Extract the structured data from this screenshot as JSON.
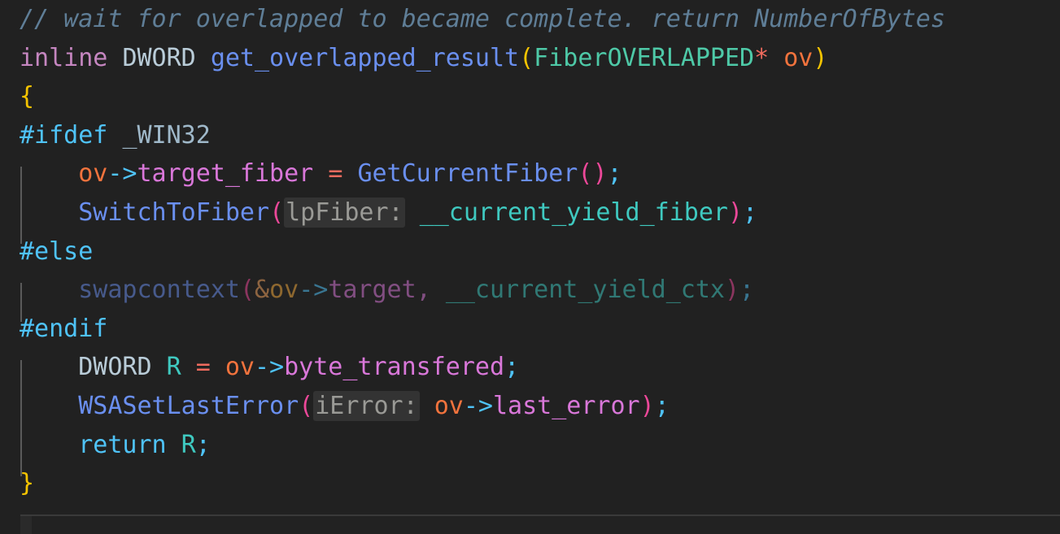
{
  "editor": {
    "language": "C++",
    "background_color": "#212121",
    "font_size_px": 30,
    "line_height_px": 47.6,
    "indent_guide_color": "#5a5a5a",
    "inlay_hint_background": "#333333",
    "inlay_hint_color": "#9a9a96"
  },
  "colors": {
    "comment": "#5f7e97",
    "keyword": "#c586c0",
    "type": "#b9ccd8",
    "function": "#6a8fef",
    "class_name": "#4ec9a7",
    "operator_red": "#f06b5e",
    "variable": "#f2733d",
    "arrow": "#4fc3f7",
    "member": "#d977d9",
    "brace_yellow": "#f5c400",
    "paren_magenta": "#ec4899",
    "preprocessor": "#4fc3f7",
    "macro": "#9fb8c9",
    "global": "#3fc9c0",
    "local": "#3fc9c0"
  },
  "code": {
    "line1": {
      "comment": "// wait for overlapped to became complete. return NumberOfBytes"
    },
    "line2": {
      "keyword": "inline",
      "space1": " ",
      "type": "DWORD",
      "space2": " ",
      "function": "get_overlapped_result",
      "paren_open": "(",
      "class_name": "FiberOVERLAPPED",
      "star": "*",
      "space3": " ",
      "param": "ov",
      "paren_close": ")"
    },
    "line3": {
      "brace_open": "{"
    },
    "line4": {
      "preproc": "#ifdef",
      "space": " ",
      "macro": "_WIN32"
    },
    "line5": {
      "indent": "    ",
      "var": "ov",
      "arrow": "->",
      "member": "target_fiber",
      "space1": " ",
      "equals": "=",
      "space2": " ",
      "function": "GetCurrentFiber",
      "paren_open": "(",
      "paren_close": ")",
      "semicolon": ";"
    },
    "line6": {
      "indent": "    ",
      "function": "SwitchToFiber",
      "paren_open": "(",
      "inlay_hint": "lpFiber:",
      "space": " ",
      "arg": "__current_yield_fiber",
      "paren_close": ")",
      "semicolon": ";"
    },
    "line7": {
      "preproc": "#else"
    },
    "line8": {
      "indent": "    ",
      "function": "swapcontext",
      "paren_open": "(",
      "ampersand": "&",
      "var": "ov",
      "arrow": "->",
      "member": "target",
      "comma": ",",
      "space": " ",
      "arg": "__current_yield_ctx",
      "paren_close": ")",
      "semicolon": ";",
      "state": "inactive-preprocessor-branch"
    },
    "line9": {
      "preproc": "#endif"
    },
    "line10": {
      "indent": "    ",
      "type": "DWORD",
      "space1": " ",
      "local": "R",
      "space2": " ",
      "equals": "=",
      "space3": " ",
      "var": "ov",
      "arrow": "->",
      "member": "byte_transfered",
      "semicolon": ";"
    },
    "line11": {
      "indent": "    ",
      "function": "WSASetLastError",
      "paren_open": "(",
      "inlay_hint": "iError:",
      "space": " ",
      "var": "ov",
      "arrow": "->",
      "member": "last_error",
      "paren_close": ")",
      "semicolon": ";"
    },
    "line12": {
      "indent": "    ",
      "keyword_return": "return",
      "space": " ",
      "local": "R",
      "semicolon": ";"
    },
    "line13": {
      "brace_close": "}"
    }
  }
}
